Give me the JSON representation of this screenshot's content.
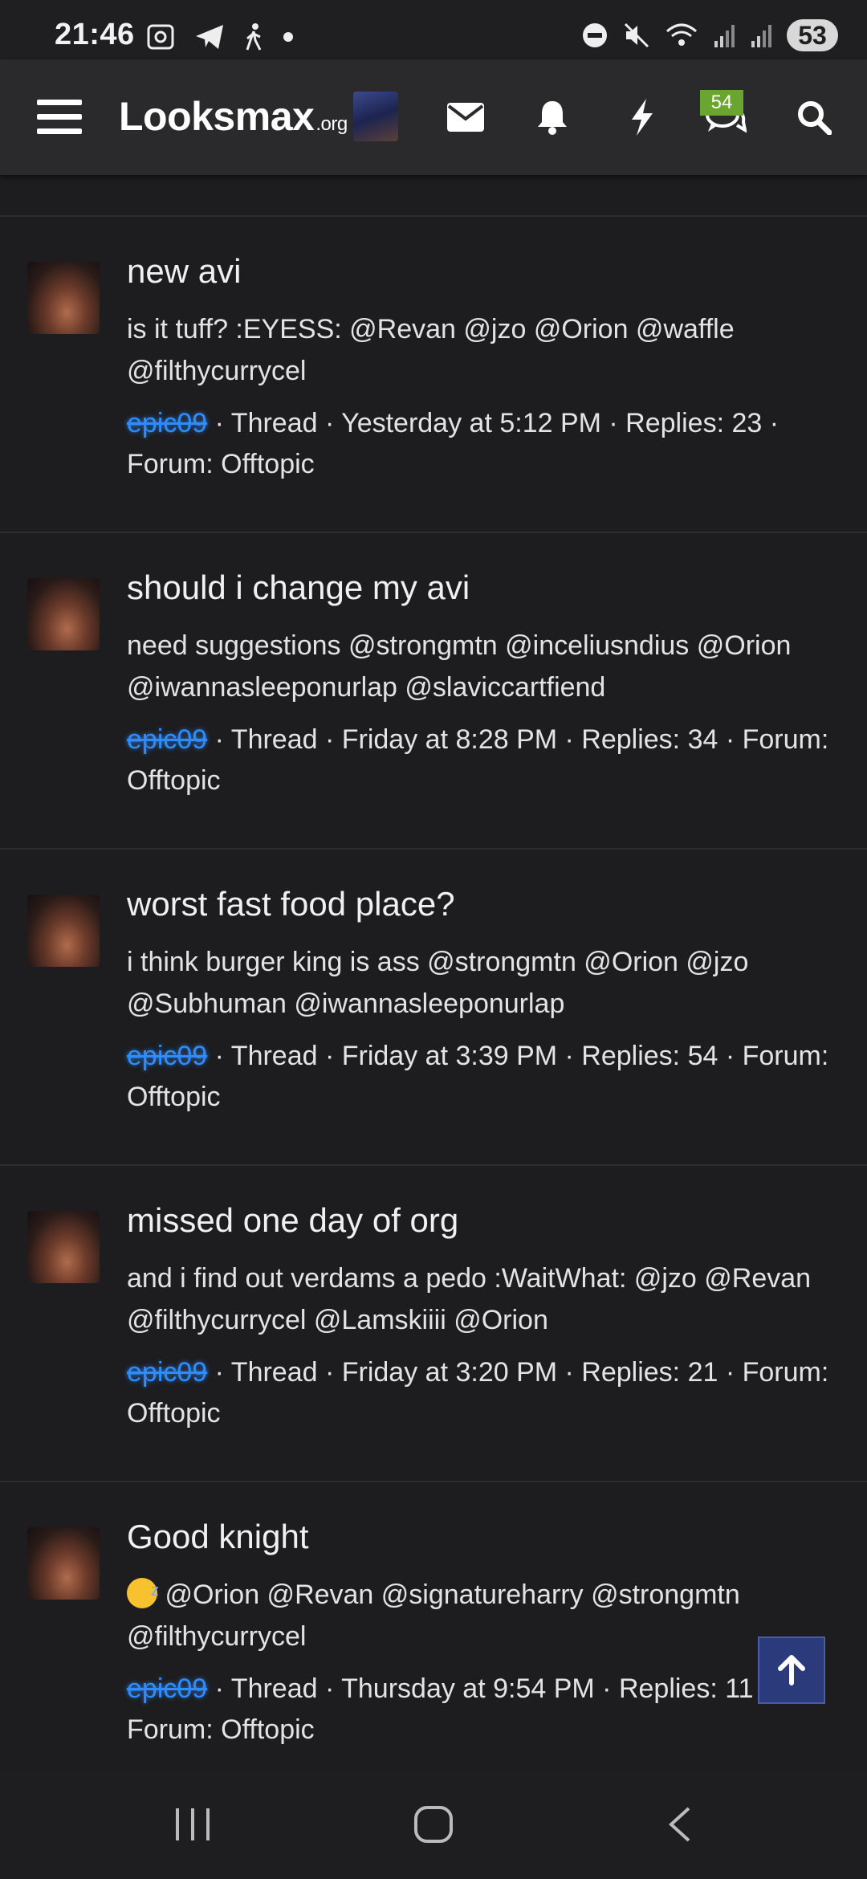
{
  "status_bar": {
    "time": "21:46",
    "battery": "53",
    "left_icons": [
      "screenshot-icon",
      "telegram-icon",
      "walk-icon",
      "dot-icon"
    ],
    "right_icons": [
      "dnd-icon",
      "mute-icon",
      "wifi-icon",
      "signal-icon",
      "signal-icon"
    ]
  },
  "nav": {
    "logo_main": "Looksmax",
    "logo_suffix": ".org",
    "chat_badge": "54",
    "icons": [
      "menu-icon",
      "mail-icon",
      "bell-icon",
      "bolt-icon",
      "chat-icon",
      "search-icon"
    ]
  },
  "threads": [
    {
      "title": "new avi",
      "body": "is it tuff? :EYESS: @Revan @jzo @Orion @waffle @filthycurrycel",
      "author": "epic09",
      "meta": " · Thread · Yesterday at 5:12 PM · Replies: 23 · ",
      "forum": "Forum: Offtopic"
    },
    {
      "title": "should i change my avi",
      "body": "need suggestions @strongmtn @inceliusndius @Orion @iwannasleeponurlap @slaviccartfiend",
      "author": "epic09",
      "meta": " · Thread · Friday at 8:28 PM · Replies: 34 · ",
      "forum": "Forum: Offtopic"
    },
    {
      "title": "worst fast food place?",
      "body": "i think burger king is ass @strongmtn @Orion @jzo @Subhuman @iwannasleeponurlap",
      "author": "epic09",
      "meta": " · Thread · Friday at 3:39 PM · Replies: 54 · ",
      "forum": "Forum: Offtopic"
    },
    {
      "title": "missed one day of org",
      "body": "and i find out verdams a pedo :WaitWhat: @jzo @Revan @filthycurrycel @Lamskiiii @Orion",
      "author": "epic09",
      "meta": " · Thread · Friday at 3:20 PM · Replies: 21 · ",
      "forum": "Forum: Offtopic"
    },
    {
      "title": "Good knight",
      "body": " @Orion @Revan @signatureharry @strongmtn @filthycurrycel",
      "author": "epic09",
      "meta": " · Thread · Thursday at 9:54 PM · Replies: 11 · ",
      "forum": "Forum: Offtopic"
    }
  ],
  "system_nav": [
    "recents-icon",
    "home-icon",
    "back-icon"
  ]
}
